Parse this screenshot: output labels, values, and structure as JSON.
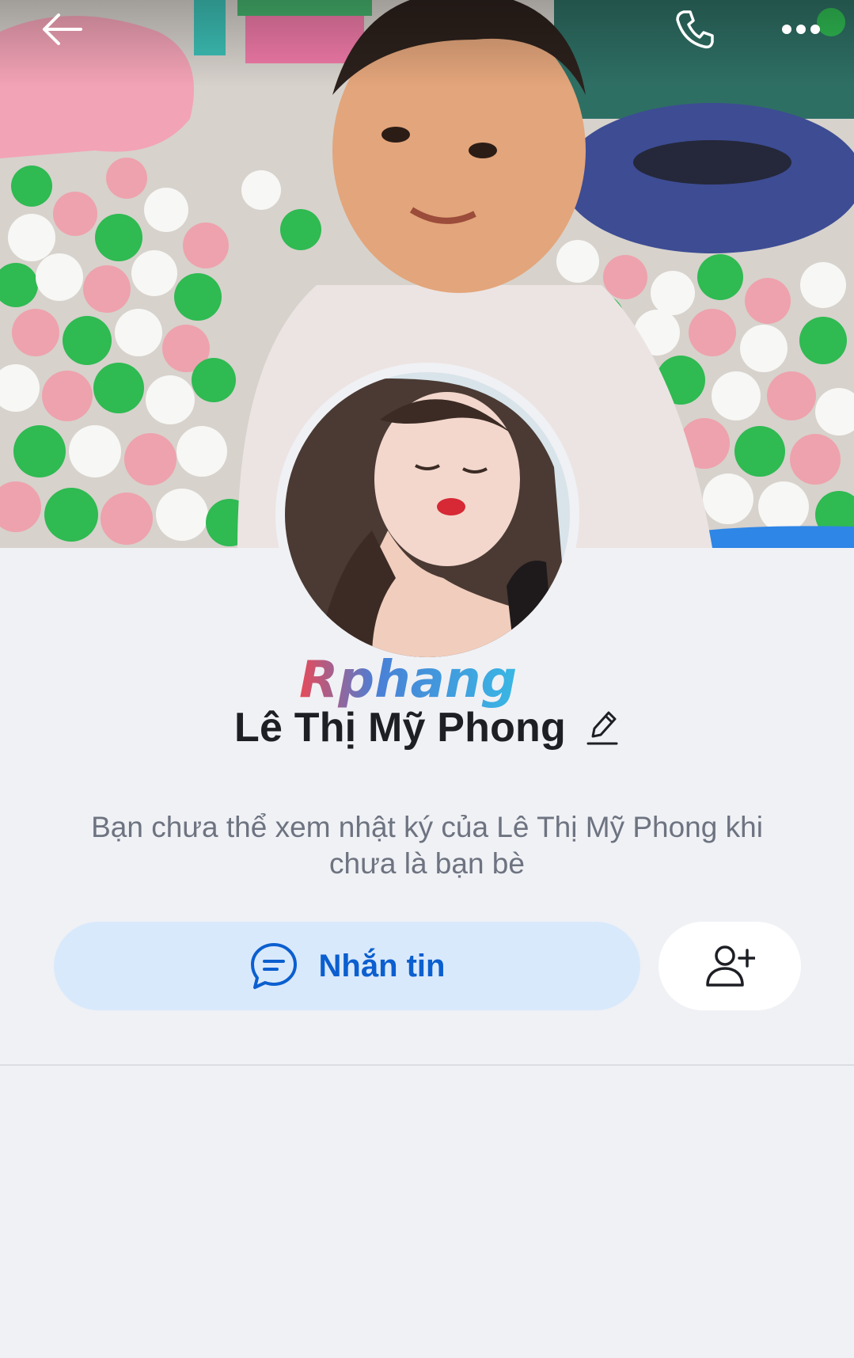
{
  "header": {
    "back_icon": "arrow-left-icon",
    "call_icon": "phone-icon",
    "more_icon": "more-dots-icon"
  },
  "profile": {
    "name": "Lê Thị Mỹ Phong",
    "edit_icon": "pencil-icon",
    "notice": "Bạn chưa thể xem nhật ký của Lê Thị Mỹ Phong khi chưa là bạn bè"
  },
  "watermark": {
    "text": "Rphang"
  },
  "actions": {
    "message_label": "Nhắn tin",
    "message_icon": "chat-bubble-icon",
    "add_friend_icon": "add-user-icon"
  },
  "colors": {
    "accent": "#0b5fcf",
    "message_button_bg": "#d9e9fc",
    "background": "#f0f1f5"
  }
}
